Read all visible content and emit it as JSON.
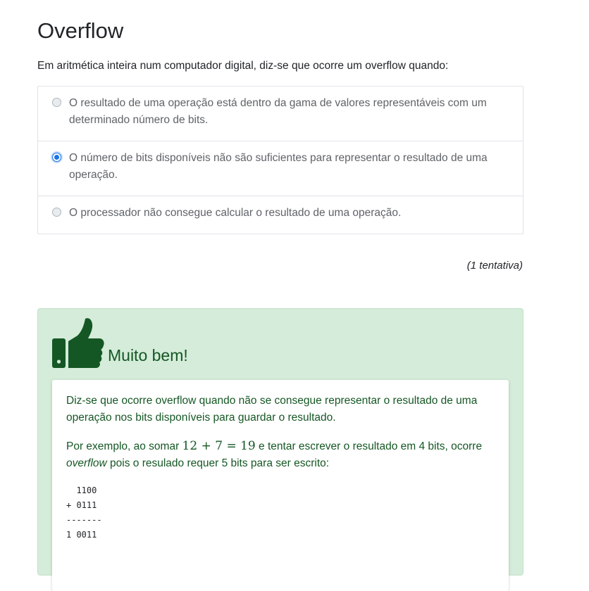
{
  "title": "Overflow",
  "question": "Em aritmética inteira num computador digital, diz-se que ocorre um overflow quando:",
  "options": [
    {
      "label": "O resultado de uma operação está dentro da gama de valores representáveis com um determinado número de bits.",
      "selected": false
    },
    {
      "label": "O número de bits disponíveis não são suficientes para representar o resultado de uma operação.",
      "selected": true
    },
    {
      "label": "O processador não consegue calcular o resultado de uma operação.",
      "selected": false
    }
  ],
  "attempts": "(1 tentativa)",
  "feedback": {
    "icon": "thumbs-up-icon",
    "title": "Muito bem!",
    "paragraph1": "Diz-se que ocorre overflow quando não se consegue representar o resultado de uma operação nos bits disponíveis para guardar o resultado.",
    "paragraph2_before": "Por exemplo, ao somar ",
    "math": "12 + 7 = 19",
    "paragraph2_middle": " e tentar escrever o resultado em 4 bits, ocorre ",
    "paragraph2_em": "overflow",
    "paragraph2_after": " pois o resulado requer 5 bits para ser escrito:",
    "code_lines": [
      "  1100",
      "+ 0111",
      "-------",
      "1 0011"
    ]
  },
  "colors": {
    "feedback_bg": "#d4ecd9",
    "feedback_text": "#155724",
    "radio_selected": "#1a73e8"
  }
}
